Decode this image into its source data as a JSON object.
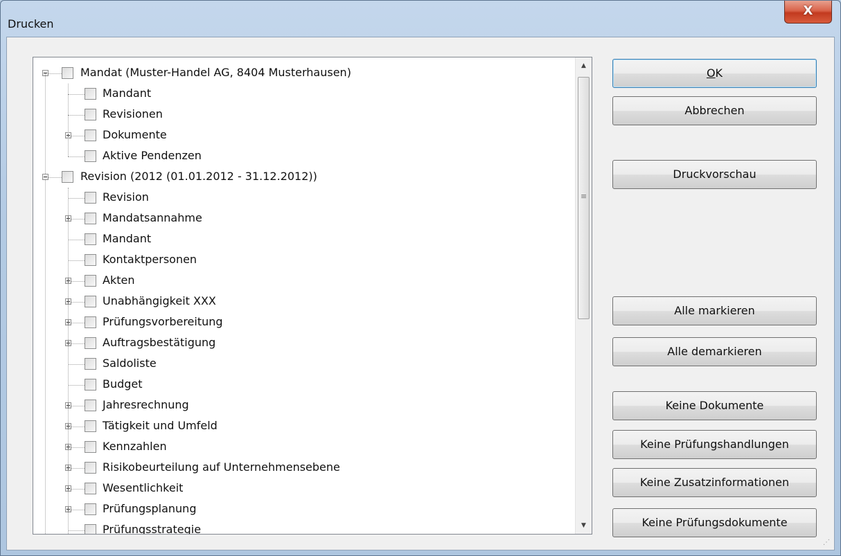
{
  "window": {
    "title": "Drucken",
    "close_label": "X"
  },
  "tree": {
    "items": [
      {
        "label": "Mandat (Muster-Handel AG, 8404 Musterhausen)",
        "level": 0,
        "expander": "minus"
      },
      {
        "label": "Mandant",
        "level": 1,
        "expander": "none"
      },
      {
        "label": "Revisionen",
        "level": 1,
        "expander": "none"
      },
      {
        "label": "Dokumente",
        "level": 1,
        "expander": "plus"
      },
      {
        "label": "Aktive Pendenzen",
        "level": 1,
        "expander": "none"
      },
      {
        "label": "Revision (2012 (01.01.2012 - 31.12.2012))",
        "level": 0,
        "expander": "minus"
      },
      {
        "label": "Revision",
        "level": 1,
        "expander": "none"
      },
      {
        "label": "Mandatsannahme",
        "level": 1,
        "expander": "plus"
      },
      {
        "label": "Mandant",
        "level": 1,
        "expander": "none"
      },
      {
        "label": "Kontaktpersonen",
        "level": 1,
        "expander": "none"
      },
      {
        "label": "Akten",
        "level": 1,
        "expander": "plus"
      },
      {
        "label": "Unabhängigkeit XXX",
        "level": 1,
        "expander": "plus"
      },
      {
        "label": "Prüfungsvorbereitung",
        "level": 1,
        "expander": "plus"
      },
      {
        "label": "Auftragsbestätigung",
        "level": 1,
        "expander": "plus"
      },
      {
        "label": "Saldoliste",
        "level": 1,
        "expander": "none"
      },
      {
        "label": "Budget",
        "level": 1,
        "expander": "none"
      },
      {
        "label": "Jahresrechnung",
        "level": 1,
        "expander": "plus"
      },
      {
        "label": "Tätigkeit und Umfeld",
        "level": 1,
        "expander": "plus"
      },
      {
        "label": "Kennzahlen",
        "level": 1,
        "expander": "plus"
      },
      {
        "label": "Risikobeurteilung auf Unternehmensebene",
        "level": 1,
        "expander": "plus"
      },
      {
        "label": "Wesentlichkeit",
        "level": 1,
        "expander": "plus"
      },
      {
        "label": "Prüfungsplanung",
        "level": 1,
        "expander": "plus"
      },
      {
        "label": "Prüfungsstrategie",
        "level": 1,
        "expander": "none"
      }
    ]
  },
  "buttons": {
    "ok_prefix": "",
    "ok_underlined": "O",
    "ok_rest": "K",
    "cancel": "Abbrechen",
    "preview": "Druckvorschau",
    "select_all": "Alle markieren",
    "deselect_all": "Alle demarkieren",
    "no_documents": "Keine Dokumente",
    "no_procedures": "Keine Prüfungshandlungen",
    "no_additional_info": "Keine Zusatzinformationen",
    "no_audit_documents": "Keine Prüfungsdokumente"
  }
}
